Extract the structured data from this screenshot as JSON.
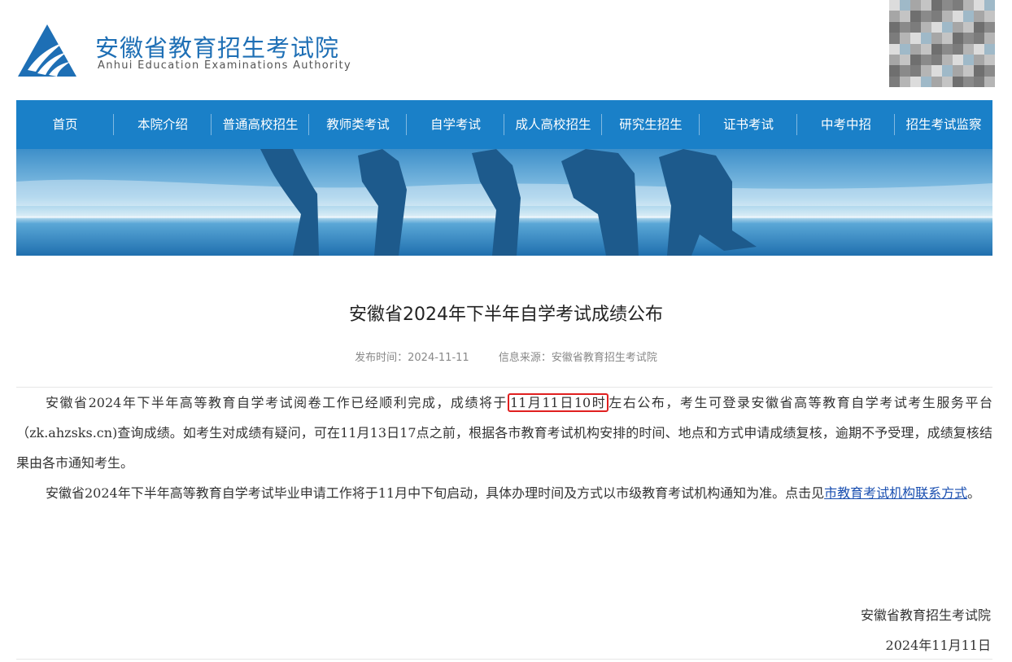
{
  "header": {
    "org_name_cn": "安徽省教育招生考试院",
    "org_name_en": "Anhui Education Examinations Authority",
    "logo_icon": "triangle-logo-icon",
    "qr_icon": "qr-code-icon"
  },
  "nav": {
    "items": [
      {
        "label": "首页"
      },
      {
        "label": "本院介绍"
      },
      {
        "label": "普通高校招生"
      },
      {
        "label": "教师类考试"
      },
      {
        "label": "自学考试"
      },
      {
        "label": "成人高校招生"
      },
      {
        "label": "研究生招生"
      },
      {
        "label": "证书考试"
      },
      {
        "label": "中考中招"
      },
      {
        "label": "招生考试监察"
      }
    ]
  },
  "article": {
    "title": "安徽省2024年下半年自学考试成绩公布",
    "publish_time": "发布时间：2024-11-11",
    "source": "信息来源：安徽省教育招生考试院",
    "p1_before": "安徽省2024年下半年高等教育自学考试阅卷工作已经顺利完成，成绩将于",
    "p1_highlight": "11月11日10时",
    "p1_after": "左右公布，考生可登录安徽省高等教育自学考试考生服务平台（zk.ahzsks.cn)查询成绩。如考生对成绩有疑问，可在11月13日17点之前，根据各市教育考试机构安排的时间、地点和方式申请成绩复核，逾期不予受理，成绩复核结果由各市通知考生。",
    "p2_before": "安徽省2024年下半年高等教育自学考试毕业申请工作将于11月中下旬启动，具体办理时间及方式以市级教育考试机构通知为准。点击见",
    "p2_link": "市教育考试机构联系方式",
    "p2_after": "。",
    "signature_org": "安徽省教育招生考试院",
    "signature_date": "2024年11月11日"
  },
  "colors": {
    "brand": "#1e6fb5",
    "nav_bg": "#1a80c8",
    "highlight_border": "#e02020",
    "link": "#1a4fb0"
  }
}
